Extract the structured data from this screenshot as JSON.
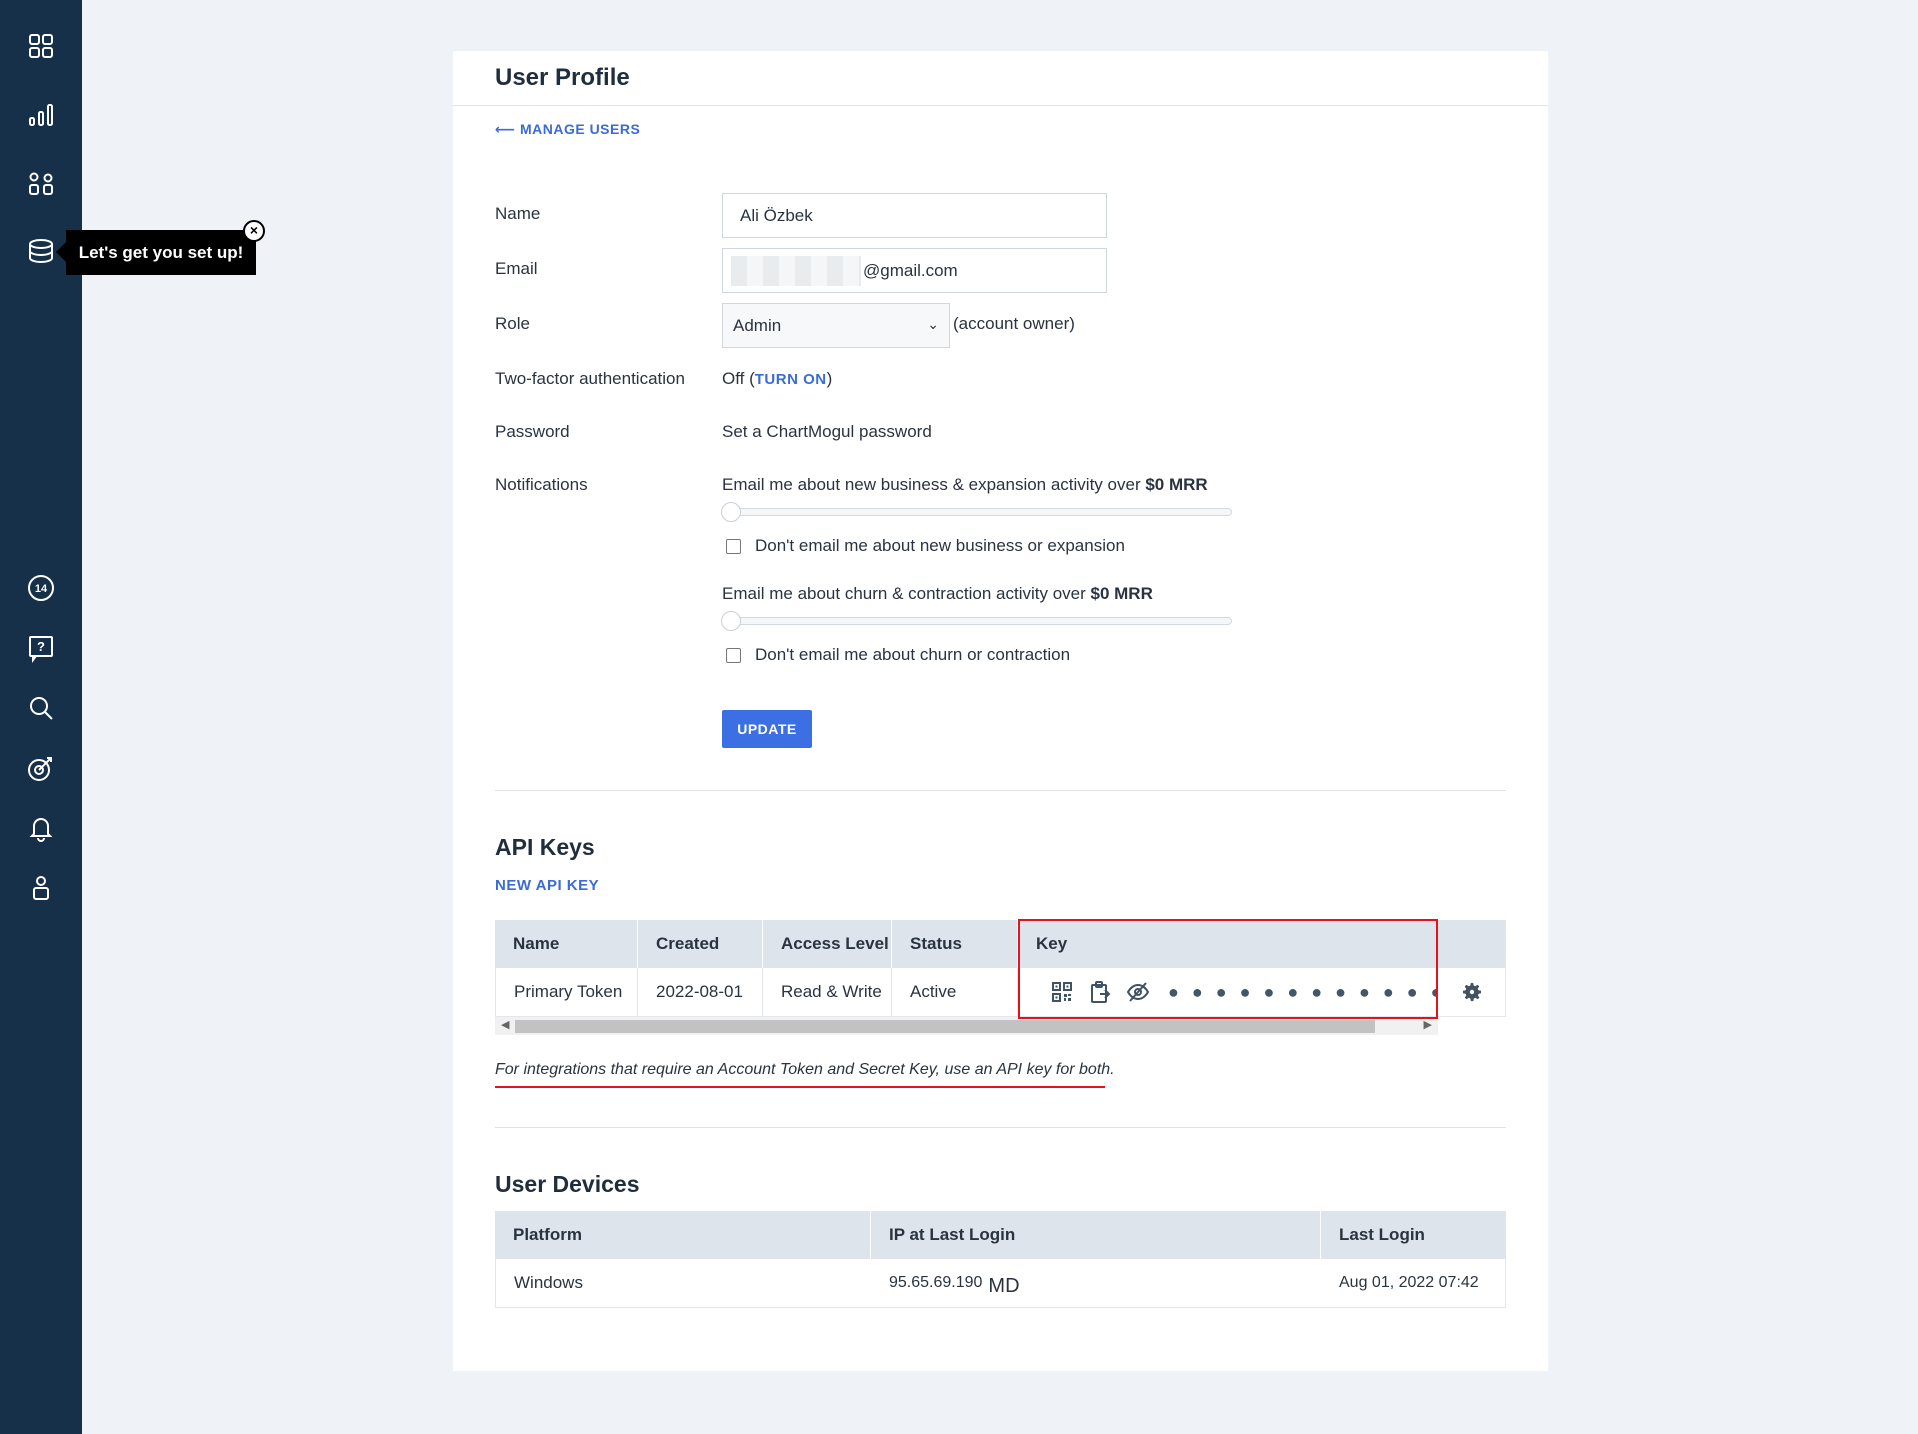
{
  "sidebar": {
    "tooltip": "Let's get you set up!",
    "tooltip_close": "×",
    "notification_count": "14"
  },
  "page": {
    "title": "User Profile",
    "back_link": "⟵ MANAGE USERS"
  },
  "form": {
    "name_label": "Name",
    "name_value": "Ali Özbek",
    "email_label": "Email",
    "email_value": "@gmail.com",
    "role_label": "Role",
    "role_value": "Admin",
    "role_note": "(account owner)",
    "twofa_label": "Two-factor authentication",
    "twofa_status": "Off (",
    "twofa_link": "TURN ON",
    "twofa_close": ")",
    "password_label": "Password",
    "password_link": "Set a ChartMogul password",
    "notifications_label": "Notifications",
    "notif_new_text": "Email me about new business & expansion activity over ",
    "notif_new_amount": "$0 MRR",
    "notif_new_checkbox": "Don't email me about new business or expansion",
    "notif_churn_text": "Email me about churn & contraction activity over ",
    "notif_churn_amount": "$0 MRR",
    "notif_churn_checkbox": "Don't email me about churn or contraction",
    "update_button": "UPDATE"
  },
  "api_keys": {
    "title": "API Keys",
    "new_link": "NEW API KEY",
    "columns": [
      "Name",
      "Created",
      "Access Level",
      "Status",
      "Key"
    ],
    "rows": [
      {
        "name": "Primary Token",
        "created": "2022-08-01",
        "access": "Read & Write",
        "status": "Active",
        "key_masked": "● ● ● ● ● ● ● ● ● ● ● ● ● ● ● ● ●"
      }
    ],
    "note": "For integrations that require an Account Token and Secret Key, use an API key for both."
  },
  "devices": {
    "title": "User Devices",
    "columns": [
      "Platform",
      "IP at Last Login",
      "Last Login"
    ],
    "rows": [
      {
        "platform": "Windows",
        "ip": "95.65.69.190",
        "country": "MD",
        "last_login": "Aug 01, 2022 07:42"
      }
    ]
  },
  "colors": {
    "sidebar_bg": "#16304a",
    "accent": "#3b6fe3",
    "link": "#3b6bd6",
    "highlight": "#e0141e",
    "table_header_bg": "#dde4ec"
  }
}
